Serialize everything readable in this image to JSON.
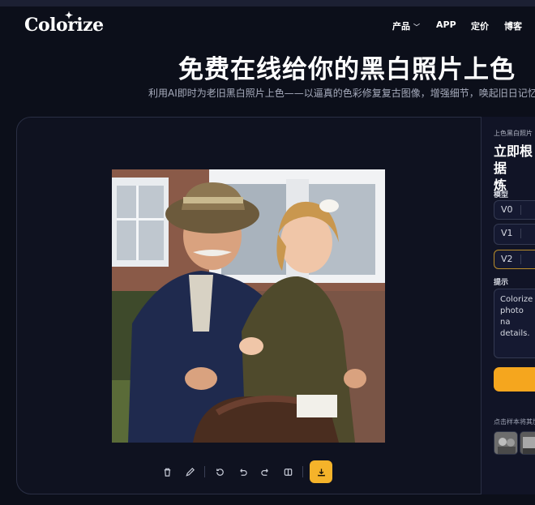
{
  "brand": {
    "name": "Colorize"
  },
  "nav": {
    "products": "产品",
    "app": "APP",
    "pricing": "定价",
    "blog": "博客"
  },
  "hero": {
    "title": "免费在线给你的黑白照片上色",
    "subtitle": "利用AI即时为老旧黑白照片上色——以逼真的色彩修复复古图像，增强细节，唤起旧日记忆。"
  },
  "panel": {
    "overline": "上色黑白照片",
    "title": "立即根据提示词修改并训练",
    "title_visible": "立即根据\n炼",
    "model_label": "模型",
    "models": [
      {
        "label": "V0",
        "selected": false
      },
      {
        "label": "V1",
        "selected": false
      },
      {
        "label": "V2",
        "selected": true
      }
    ],
    "prompt_label": "提示",
    "prompt_text": "Colorize photo na details.",
    "hint": "点击样本将其加"
  },
  "toolbar": {
    "tools": [
      "trash-icon",
      "pencil-icon",
      "rotate-icon",
      "undo-icon",
      "redo-icon",
      "compare-icon",
      "download-icon"
    ]
  },
  "colors": {
    "background": "#0c0f1a",
    "accent": "#f5b32a",
    "card_border": "#2a2f44"
  }
}
